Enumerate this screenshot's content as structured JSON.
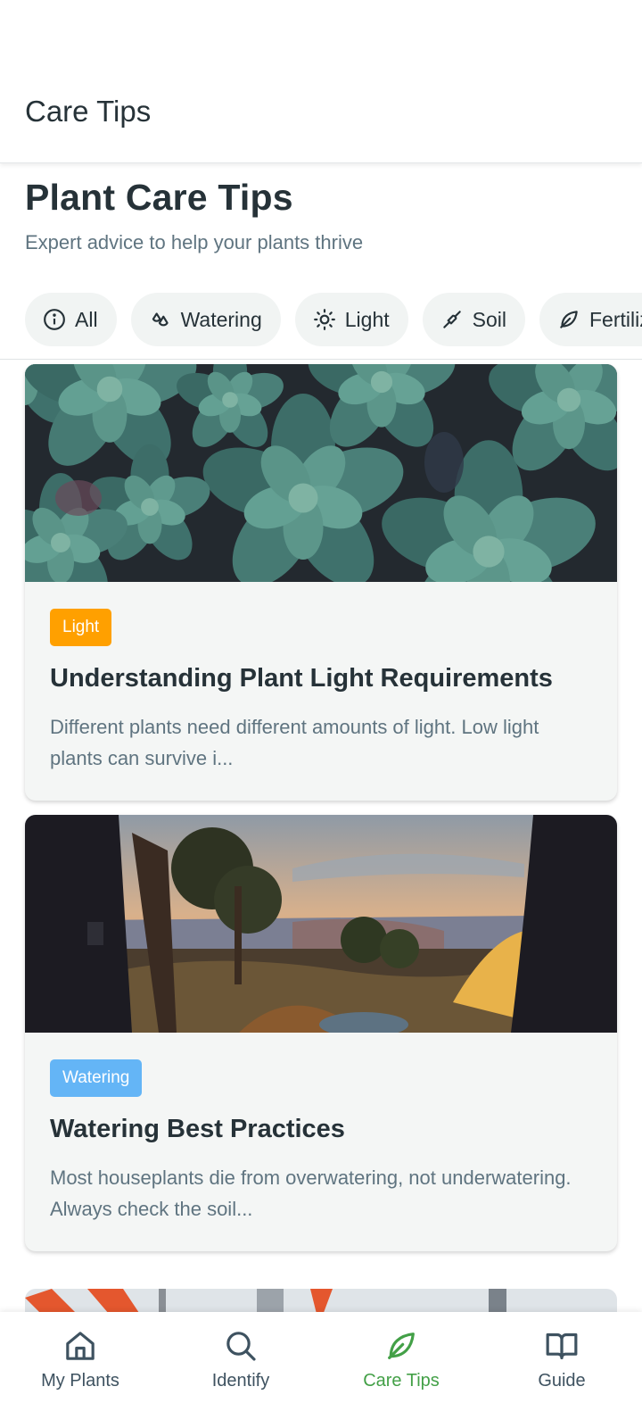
{
  "app_bar": {
    "title": "Care Tips"
  },
  "header": {
    "title": "Plant Care Tips",
    "subtitle": "Expert advice to help your plants thrive"
  },
  "filters": [
    {
      "label": "All",
      "icon": "info-icon"
    },
    {
      "label": "Watering",
      "icon": "water-drops-icon"
    },
    {
      "label": "Light",
      "icon": "sun-icon"
    },
    {
      "label": "Soil",
      "icon": "trowel-icon"
    },
    {
      "label": "Fertilizer",
      "icon": "leaf-icon"
    }
  ],
  "cards": [
    {
      "category": "Light",
      "category_color": "#ffa000",
      "title": "Understanding Plant Light Requirements",
      "excerpt": "Different plants need different amounts of light. Low light plants can survive i...",
      "image": "succulents-photo"
    },
    {
      "category": "Watering",
      "category_color": "#64b5f6",
      "title": "Watering Best Practices",
      "excerpt": "Most houseplants die from overwatering, not underwatering. Always check the soil...",
      "image": "camping-sunset-photo"
    }
  ],
  "bottom_nav": [
    {
      "label": "My Plants",
      "icon": "home-icon",
      "active": false
    },
    {
      "label": "Identify",
      "icon": "search-icon",
      "active": false
    },
    {
      "label": "Care Tips",
      "icon": "leaf-icon",
      "active": true
    },
    {
      "label": "Guide",
      "icon": "book-icon",
      "active": false
    }
  ],
  "colors": {
    "accent": "#43a047",
    "text": "#263238",
    "muted": "#5f7480"
  }
}
